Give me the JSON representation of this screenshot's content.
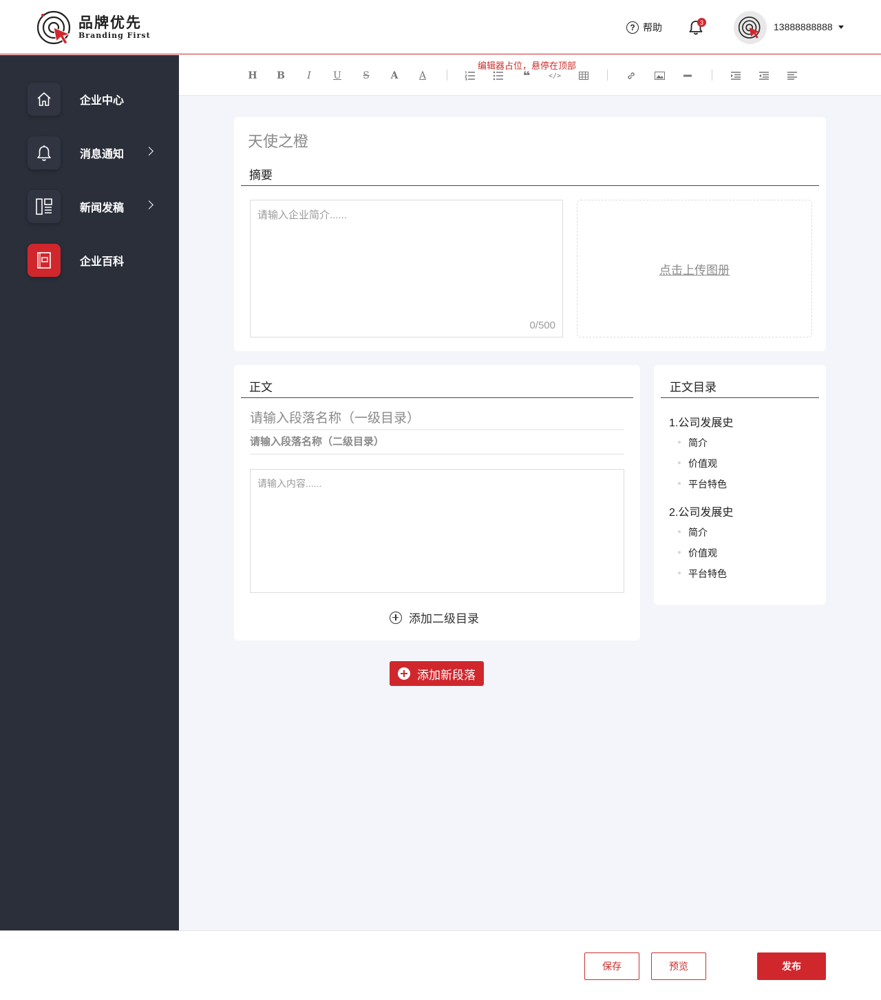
{
  "header": {
    "logo_cn": "品牌优先",
    "logo_en": "Branding First",
    "help_label": "帮助",
    "notification_count": "3",
    "username": "13888888888"
  },
  "sidebar": {
    "items": [
      {
        "label": "企业中心",
        "icon": "home-icon",
        "has_submenu": false,
        "active": false
      },
      {
        "label": "消息通知",
        "icon": "bell-icon",
        "has_submenu": true,
        "active": false
      },
      {
        "label": "新闻发稿",
        "icon": "layout-icon",
        "has_submenu": true,
        "active": false
      },
      {
        "label": "企业百科",
        "icon": "book-icon",
        "has_submenu": false,
        "active": true
      }
    ]
  },
  "toolbar": {
    "note": "编辑器占位，悬停在顶部",
    "buttons": [
      "heading-icon",
      "bold-icon",
      "italic-icon",
      "underline-icon",
      "strikethrough-icon",
      "font-color-icon",
      "highlight-icon",
      "ordered-list-icon",
      "bullet-list-icon",
      "quote-icon",
      "code-icon",
      "table-icon",
      "link-icon",
      "image-icon",
      "divider-icon",
      "indent-icon",
      "outdent-icon",
      "align-left-icon"
    ]
  },
  "editor": {
    "title_placeholder": "天使之橙",
    "summary_title": "摘要",
    "summary_placeholder": "请输入企业简介......",
    "summary_counter": "0/500",
    "upload_label": "点击上传图册",
    "body_title": "正文",
    "h1_placeholder": "请输入段落名称（一级目录）",
    "h2_placeholder": "请输入段落名称（二级目录）",
    "content_placeholder": "请输入内容......",
    "add_sub_label": "添加二级目录",
    "add_para_label": "添加新段落"
  },
  "toc": {
    "title": "正文目录",
    "sections": [
      {
        "label": "1.公司发展史",
        "items": [
          "简介",
          "价值观",
          "平台特色"
        ]
      },
      {
        "label": "2.公司发展史",
        "items": [
          "简介",
          "价值观",
          "平台特色"
        ]
      }
    ]
  },
  "footer": {
    "save_label": "保存",
    "preview_label": "预览",
    "publish_label": "发布"
  },
  "colors": {
    "accent": "#d0272d",
    "sidebar_bg": "#2b2f3a",
    "main_bg": "#f4f5fa"
  }
}
